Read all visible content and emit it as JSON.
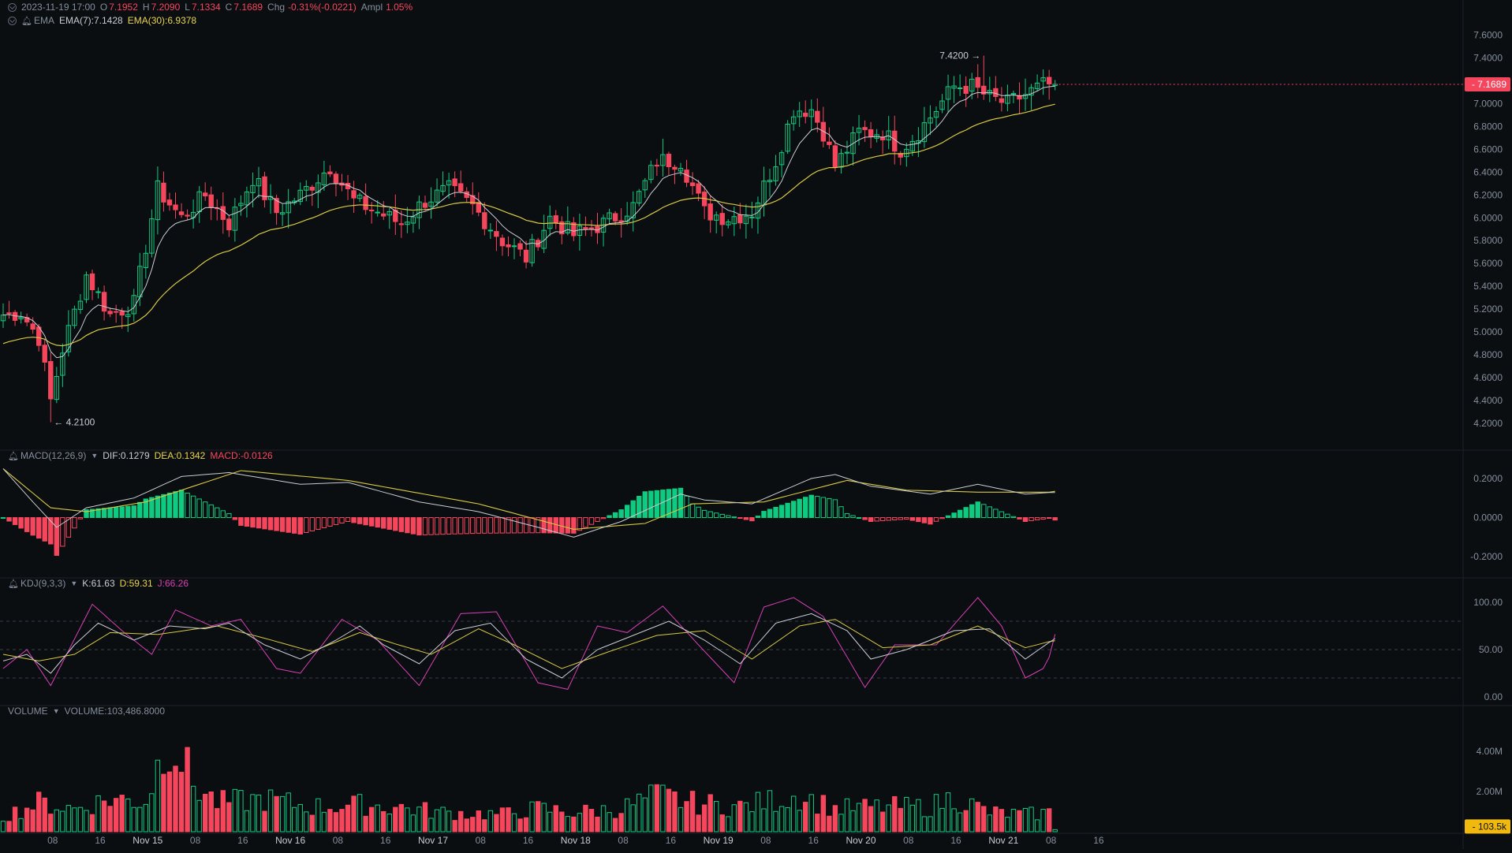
{
  "header": {
    "timestamp": "2023-11-19 17:00",
    "open_label": "O",
    "open": "7.1952",
    "high_label": "H",
    "high": "7.2090",
    "low_label": "L",
    "low": "7.1334",
    "close_label": "C",
    "close": "7.1689",
    "chg_label": "Chg",
    "chg": "-0.31%(-0.0221)",
    "ampl_label": "Ampl",
    "ampl": "1.05%"
  },
  "ema_header": {
    "label": "EMA",
    "ema7": "EMA(7):7.1428",
    "ema30": "EMA(30):6.9378"
  },
  "macd_header": {
    "label": "MACD(12,26,9)",
    "dif": "DIF:0.1279",
    "dea": "DEA:0.1342",
    "macd": "MACD:-0.0126"
  },
  "kdj_header": {
    "label": "KDJ(9,3,3)",
    "k": "K:61.63",
    "d": "D:59.31",
    "j": "J:66.26"
  },
  "volume_header": {
    "label": "VOLUME",
    "value": "VOLUME:103,486.8000"
  },
  "colors": {
    "background": "#0b0e11",
    "up": "#0ecb81",
    "down": "#f6465d",
    "ema7": "#c9ccd1",
    "ema30": "#d8c840",
    "kdj_k": "#c9ccd1",
    "kdj_d": "#d8c840",
    "kdj_j": "#d63fb6",
    "price_tag": "#f6465d",
    "volume_tag": "#f0b90b"
  },
  "chart_data": {
    "type": "candlestick",
    "interval_hours": 1,
    "x_ticks": [
      "08",
      "16",
      "Nov 15",
      "08",
      "16",
      "Nov 16",
      "08",
      "16",
      "Nov 17",
      "08",
      "16",
      "Nov 18",
      "08",
      "16",
      "Nov 19",
      "08",
      "16",
      "Nov 20",
      "08",
      "16",
      "Nov 21",
      "08",
      "16"
    ],
    "price_axis": {
      "ylim": [
        4.0,
        7.7
      ],
      "ticks": [
        "7.6000",
        "7.4000",
        "7.2000",
        "7.0000",
        "6.8000",
        "6.6000",
        "6.4000",
        "6.2000",
        "6.0000",
        "5.8000",
        "5.6000",
        "5.4000",
        "5.2000",
        "5.0000",
        "4.8000",
        "4.6000",
        "4.4000",
        "4.2000"
      ]
    },
    "last_price_tag": "7.1689",
    "high_marker": "7.4200",
    "low_marker": "4.2100",
    "close_anchors": [
      [
        0,
        5.15
      ],
      [
        3,
        5.17
      ],
      [
        6,
        4.95
      ],
      [
        8,
        4.4
      ],
      [
        10,
        4.85
      ],
      [
        14,
        5.5
      ],
      [
        18,
        5.15
      ],
      [
        22,
        5.25
      ],
      [
        26,
        6.25
      ],
      [
        30,
        6.0
      ],
      [
        34,
        6.2
      ],
      [
        38,
        5.95
      ],
      [
        42,
        6.35
      ],
      [
        46,
        6.05
      ],
      [
        50,
        6.2
      ],
      [
        55,
        6.45
      ],
      [
        59,
        6.15
      ],
      [
        63,
        6.05
      ],
      [
        67,
        5.95
      ],
      [
        71,
        6.15
      ],
      [
        75,
        6.25
      ],
      [
        79,
        6.1
      ],
      [
        84,
        5.8
      ],
      [
        88,
        5.65
      ],
      [
        92,
        6.0
      ],
      [
        96,
        5.85
      ],
      [
        101,
        5.95
      ],
      [
        106,
        6.1
      ],
      [
        110,
        6.5
      ],
      [
        114,
        6.5
      ],
      [
        118,
        6.05
      ],
      [
        122,
        6.0
      ],
      [
        126,
        6.05
      ],
      [
        130,
        6.5
      ],
      [
        133,
        6.95
      ],
      [
        136,
        6.95
      ],
      [
        138,
        6.75
      ],
      [
        140,
        6.45
      ],
      [
        144,
        6.75
      ],
      [
        148,
        6.75
      ],
      [
        151,
        6.6
      ],
      [
        154,
        6.75
      ],
      [
        157,
        6.95
      ],
      [
        160,
        7.15
      ],
      [
        163,
        7.15
      ],
      [
        166,
        7.05
      ],
      [
        169,
        7.0
      ],
      [
        172,
        7.08
      ],
      [
        175,
        7.16
      ],
      [
        177,
        7.17
      ]
    ],
    "ema7_last": 7.1428,
    "ema30_last": 6.9378,
    "macd": {
      "ylim": [
        -0.28,
        0.26
      ],
      "ticks": [
        "0.2000",
        "0.0000",
        "-0.2000"
      ],
      "dif_last": 0.1279,
      "dea_last": 0.1342,
      "hist_last": -0.0126,
      "dif_anchors": [
        [
          0,
          0.25
        ],
        [
          5,
          0.08
        ],
        [
          9,
          -0.05
        ],
        [
          14,
          0.05
        ],
        [
          22,
          0.1
        ],
        [
          30,
          0.21
        ],
        [
          38,
          0.23
        ],
        [
          50,
          0.17
        ],
        [
          58,
          0.18
        ],
        [
          70,
          0.08
        ],
        [
          80,
          0.03
        ],
        [
          90,
          -0.05
        ],
        [
          96,
          -0.1
        ],
        [
          104,
          -0.02
        ],
        [
          114,
          0.12
        ],
        [
          118,
          0.09
        ],
        [
          126,
          0.07
        ],
        [
          136,
          0.2
        ],
        [
          140,
          0.22
        ],
        [
          146,
          0.16
        ],
        [
          156,
          0.12
        ],
        [
          164,
          0.17
        ],
        [
          172,
          0.12
        ],
        [
          177,
          0.13
        ]
      ],
      "dea_anchors": [
        [
          0,
          0.25
        ],
        [
          8,
          0.05
        ],
        [
          14,
          0.03
        ],
        [
          24,
          0.08
        ],
        [
          40,
          0.24
        ],
        [
          58,
          0.19
        ],
        [
          80,
          0.07
        ],
        [
          96,
          -0.06
        ],
        [
          108,
          -0.03
        ],
        [
          116,
          0.07
        ],
        [
          128,
          0.08
        ],
        [
          142,
          0.19
        ],
        [
          152,
          0.14
        ],
        [
          164,
          0.13
        ],
        [
          177,
          0.13
        ]
      ]
    },
    "kdj": {
      "ylim": [
        -5,
        110
      ],
      "ticks": [
        "100.00",
        "50.00",
        "0.00"
      ],
      "k": 61.63,
      "d": 59.31,
      "j": 66.26,
      "k_anchors": [
        [
          0,
          38
        ],
        [
          4,
          45
        ],
        [
          8,
          25
        ],
        [
          12,
          55
        ],
        [
          16,
          78
        ],
        [
          22,
          60
        ],
        [
          28,
          75
        ],
        [
          34,
          72
        ],
        [
          38,
          78
        ],
        [
          44,
          55
        ],
        [
          50,
          40
        ],
        [
          56,
          60
        ],
        [
          60,
          75
        ],
        [
          64,
          55
        ],
        [
          70,
          35
        ],
        [
          76,
          70
        ],
        [
          82,
          78
        ],
        [
          88,
          40
        ],
        [
          94,
          20
        ],
        [
          100,
          50
        ],
        [
          106,
          65
        ],
        [
          112,
          80
        ],
        [
          118,
          60
        ],
        [
          124,
          35
        ],
        [
          130,
          78
        ],
        [
          136,
          88
        ],
        [
          142,
          70
        ],
        [
          146,
          40
        ],
        [
          152,
          50
        ],
        [
          160,
          70
        ],
        [
          166,
          72
        ],
        [
          172,
          40
        ],
        [
          177,
          62
        ]
      ],
      "d_anchors": [
        [
          0,
          45
        ],
        [
          6,
          38
        ],
        [
          12,
          45
        ],
        [
          18,
          68
        ],
        [
          26,
          66
        ],
        [
          36,
          75
        ],
        [
          44,
          62
        ],
        [
          52,
          48
        ],
        [
          60,
          68
        ],
        [
          66,
          56
        ],
        [
          72,
          45
        ],
        [
          80,
          72
        ],
        [
          86,
          55
        ],
        [
          94,
          30
        ],
        [
          102,
          48
        ],
        [
          110,
          65
        ],
        [
          118,
          70
        ],
        [
          126,
          40
        ],
        [
          134,
          75
        ],
        [
          140,
          82
        ],
        [
          148,
          52
        ],
        [
          156,
          55
        ],
        [
          164,
          75
        ],
        [
          172,
          52
        ],
        [
          177,
          60
        ]
      ],
      "j_anchors": [
        [
          0,
          30
        ],
        [
          4,
          50
        ],
        [
          8,
          12
        ],
        [
          15,
          98
        ],
        [
          20,
          70
        ],
        [
          25,
          45
        ],
        [
          29,
          92
        ],
        [
          35,
          75
        ],
        [
          40,
          82
        ],
        [
          46,
          30
        ],
        [
          50,
          25
        ],
        [
          57,
          82
        ],
        [
          63,
          60
        ],
        [
          70,
          12
        ],
        [
          77,
          88
        ],
        [
          83,
          90
        ],
        [
          90,
          15
        ],
        [
          95,
          8
        ],
        [
          100,
          75
        ],
        [
          105,
          68
        ],
        [
          111,
          96
        ],
        [
          117,
          55
        ],
        [
          123,
          15
        ],
        [
          128,
          95
        ],
        [
          133,
          105
        ],
        [
          138,
          85
        ],
        [
          145,
          10
        ],
        [
          150,
          55
        ],
        [
          157,
          55
        ],
        [
          164,
          105
        ],
        [
          168,
          75
        ],
        [
          172,
          20
        ],
        [
          175,
          30
        ],
        [
          178,
          66
        ]
      ]
    },
    "volume": {
      "ylim": [
        0,
        5.6
      ],
      "unit": "M",
      "ticks": [
        "4.00M",
        "2.00M"
      ],
      "last_tag": "103.5k",
      "anchors": [
        [
          0,
          0.8
        ],
        [
          6,
          1.5
        ],
        [
          12,
          1.2
        ],
        [
          18,
          1.7
        ],
        [
          24,
          1.6
        ],
        [
          28,
          5.2
        ],
        [
          32,
          2.5
        ],
        [
          36,
          1.5
        ],
        [
          44,
          1.7
        ],
        [
          52,
          1.3
        ],
        [
          60,
          1.4
        ],
        [
          66,
          1.3
        ],
        [
          74,
          1.0
        ],
        [
          84,
          0.9
        ],
        [
          90,
          1.2
        ],
        [
          96,
          1.0
        ],
        [
          104,
          1.2
        ],
        [
          110,
          1.9
        ],
        [
          116,
          1.5
        ],
        [
          124,
          1.3
        ],
        [
          134,
          1.9
        ],
        [
          140,
          1.2
        ],
        [
          148,
          1.3
        ],
        [
          156,
          1.3
        ],
        [
          160,
          1.8
        ],
        [
          166,
          1.0
        ],
        [
          172,
          0.9
        ],
        [
          176,
          1.0
        ],
        [
          177,
          0.1
        ]
      ]
    }
  }
}
